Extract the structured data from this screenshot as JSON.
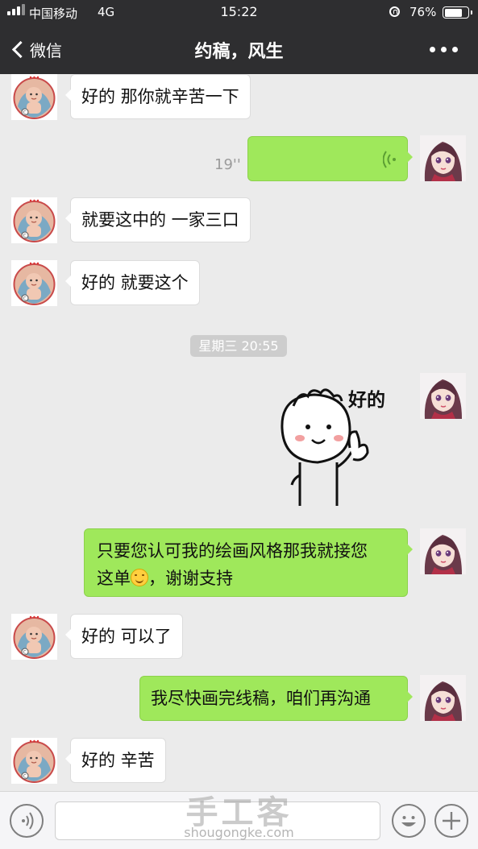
{
  "status_bar": {
    "carrier": "中国移动",
    "network": "4G",
    "time": "15:22",
    "battery_percent": "76%",
    "battery_level": 0.76
  },
  "nav": {
    "back_label": "微信",
    "title": "约稿，风生"
  },
  "messages": [
    {
      "from": "other",
      "text": "好的 那你就辛苦一下"
    },
    {
      "from": "me",
      "type": "voice",
      "duration": "19''"
    },
    {
      "from": "other",
      "text": "就要这中的 一家三口"
    },
    {
      "from": "other",
      "text": "好的 就要这个"
    },
    {
      "type": "timestamp",
      "text": "星期三 20:55"
    },
    {
      "from": "me",
      "type": "sticker",
      "sticker_text": "好的"
    },
    {
      "from": "me",
      "text_line1": "只要您认可我的绘画风格那我就接您",
      "text_line2_a": "这单",
      "text_line2_b": "，谢谢支持",
      "emoji": "smile-emoji"
    },
    {
      "from": "other",
      "text": "好的 可以了"
    },
    {
      "from": "me",
      "text": "我尽快画完线稿，咱们再沟通"
    },
    {
      "from": "other",
      "text": "好的 辛苦"
    }
  ],
  "input_bar": {
    "voice_icon": "voice-toggle-icon",
    "emoji_icon": "emoji-icon",
    "add_icon": "plus-icon"
  },
  "watermark": {
    "title": "手工客",
    "site": "shougongke.com"
  },
  "colors": {
    "header": "#2e2e30",
    "background": "#ebebeb",
    "outgoing_bubble": "#9fe85b",
    "incoming_bubble": "#ffffff"
  }
}
